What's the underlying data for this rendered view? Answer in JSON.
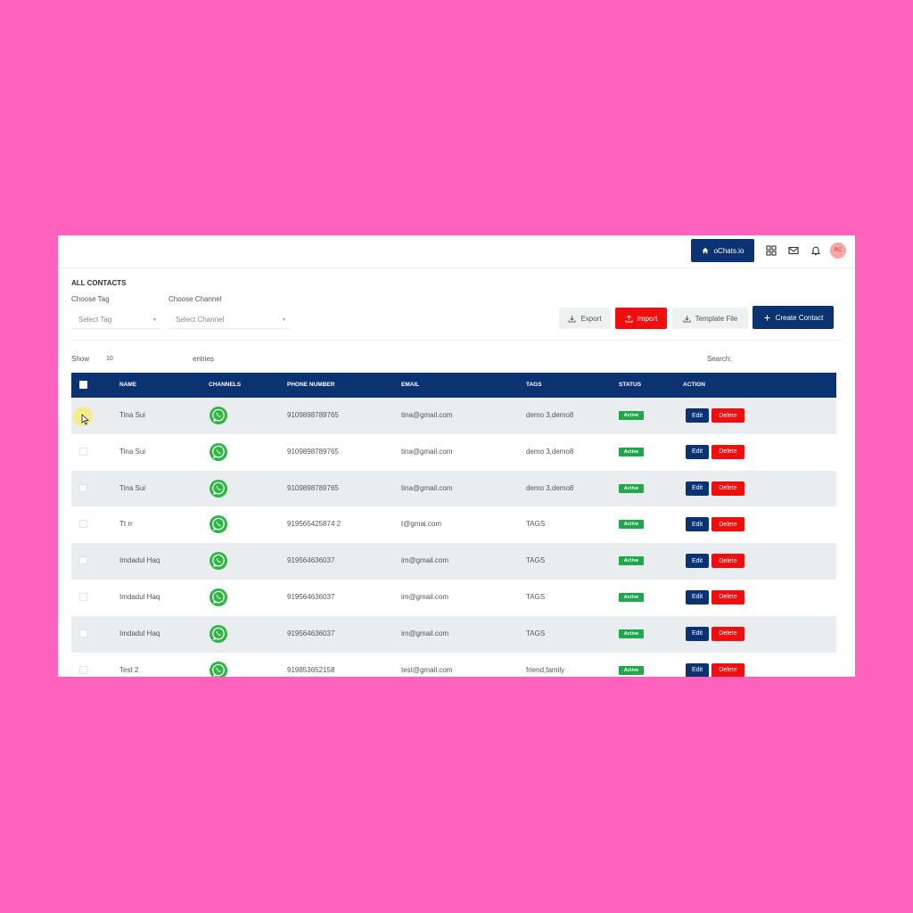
{
  "topbar": {
    "brand_label": "oChats.io",
    "icons": [
      "home-icon",
      "grid-icon",
      "mail-icon",
      "bell-icon"
    ],
    "avatar_initials": "RC"
  },
  "page": {
    "title": "ALL CONTACTS"
  },
  "filters": {
    "tag_label": "Choose Tag",
    "tag_placeholder": "Select Tag",
    "channel_label": "Choose Channel",
    "channel_placeholder": "Select Channel"
  },
  "actions": {
    "export_label": "Export",
    "import_label": "Import",
    "template_label": "Template File",
    "create_label": "Create Contact"
  },
  "table_controls": {
    "show_label": "Show",
    "entries_value": "10",
    "entries_label": "entries",
    "search_label": "Search:"
  },
  "table": {
    "columns": [
      "NAME",
      "CHANNELS",
      "PHONE NUMBER",
      "EMAIL",
      "TAGS",
      "STATUS",
      "ACTION"
    ],
    "edit_label": "Edit",
    "delete_label": "Delete",
    "rows": [
      {
        "name": "Tina Sui",
        "phone": "9109898789765",
        "email": "tina@gmail.com",
        "tags": "demo 3,demo8",
        "status": "Active"
      },
      {
        "name": "Tina Sui",
        "phone": "9109898789765",
        "email": "tina@gmail.com",
        "tags": "demo 3,demo8",
        "status": "Active"
      },
      {
        "name": "Tina Sui",
        "phone": "9109898789765",
        "email": "tina@gmail.com",
        "tags": "demo 3,demo8",
        "status": "Active"
      },
      {
        "name": "Tt rr",
        "phone": "919565425874 2",
        "email": "t@gmai.com",
        "tags": "TAGS",
        "status": "Active"
      },
      {
        "name": "Imdadul Haq",
        "phone": "919564636037",
        "email": "im@gmail.com",
        "tags": "TAGS",
        "status": "Active"
      },
      {
        "name": "Imdadul Haq",
        "phone": "919564636037",
        "email": "im@gmail.com",
        "tags": "TAGS",
        "status": "Active"
      },
      {
        "name": "Imdadul Haq",
        "phone": "919564636037",
        "email": "im@gmail.com",
        "tags": "TAGS",
        "status": "Active"
      },
      {
        "name": "Test 2",
        "phone": "919853652158",
        "email": "test@gmail.com",
        "tags": "friend,family",
        "status": "Active"
      }
    ]
  },
  "colors": {
    "background": "#ff62bd",
    "primary": "#0b3372",
    "danger": "#f00f0f",
    "success": "#1ea84a",
    "row_shade": "#eaedef"
  }
}
